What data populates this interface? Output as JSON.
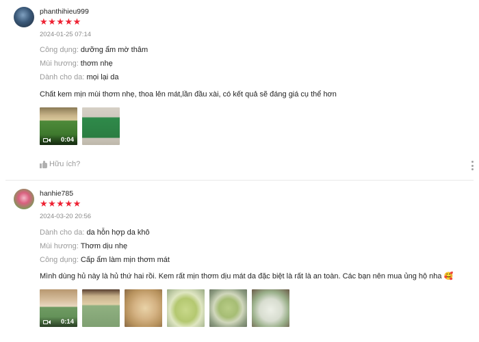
{
  "reviews": [
    {
      "username": "phanthihieu999",
      "stars": "★★★★★",
      "rating": 5,
      "timestamp": "2024-01-25 07:14",
      "attributes": [
        {
          "label": "Công dụng:",
          "value": "dưỡng ẩm mờ thâm"
        },
        {
          "label": "Mùi hương:",
          "value": "thơm nhẹ"
        },
        {
          "label": "Dành cho da:",
          "value": "mọi lại da"
        }
      ],
      "comment": "Chất kem mịn mùi thơm nhẹ, thoa lên mát,lần đầu xài, có kết quả sẽ đáng giá cụ thể hơn",
      "video_duration": "0:04",
      "helpful_label": "Hữu ích?"
    },
    {
      "username": "hanhie785",
      "stars": "★★★★★",
      "rating": 5,
      "timestamp": "2024-03-20 20:56",
      "attributes": [
        {
          "label": "Dành cho da:",
          "value": "da hỗn hợp da khô"
        },
        {
          "label": "Mùi hương:",
          "value": "Thơm dịu nhẹ"
        },
        {
          "label": "Công dụng:",
          "value": "Cấp ẩm làm mịn thơm mát"
        }
      ],
      "comment": "Mình dùng hủ này là hủ thứ hai rồi. Kem rất mịn thơm dịu mát da đặc biệt là rất là an toàn. Các bạn nên mua ủng hộ nha 🥰",
      "video_duration": "0:14"
    }
  ],
  "colors": {
    "star": "#ee2233",
    "muted": "#9a9a9a",
    "text": "#222222"
  }
}
